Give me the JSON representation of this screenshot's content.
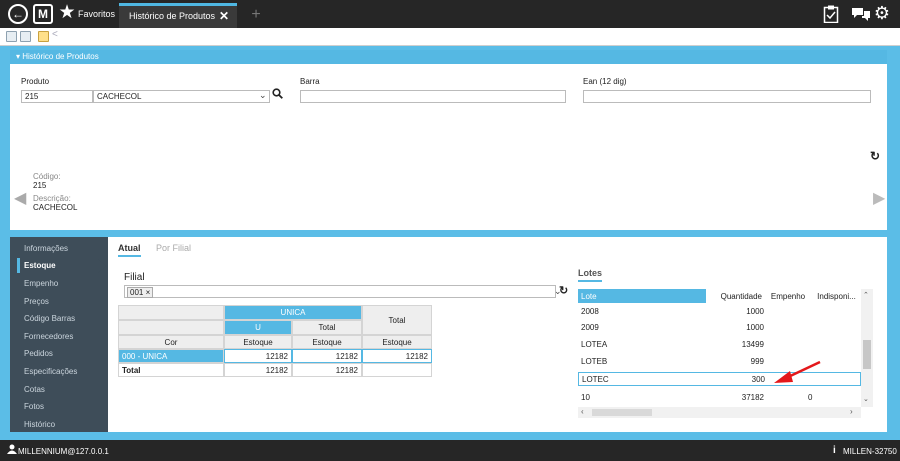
{
  "titlebar": {
    "favorites_label": "Favoritos",
    "active_tab": "Histórico de Produtos",
    "close_glyph": "✕",
    "add_glyph": "+",
    "logo_letter": "M"
  },
  "panel": {
    "title": "Histórico de Produtos"
  },
  "product": {
    "produto_label": "Produto",
    "produto_code": "215",
    "produto_name": "CACHECOL",
    "barra_label": "Barra",
    "barra_value": "",
    "ean_label": "Ean (12 dig)",
    "ean_value": "",
    "codigo_label": "Código:",
    "codigo_value": "215",
    "descricao_label": "Descrição:",
    "descricao_value": "CACHECOL"
  },
  "sidebar": {
    "items": [
      "Informações",
      "Estoque",
      "Empenho",
      "Preços",
      "Código Barras",
      "Fornecedores",
      "Pedidos",
      "Especificações",
      "Cotas",
      "Fotos",
      "Histórico"
    ],
    "active_index": 1
  },
  "content": {
    "tabs": [
      "Atual",
      "Por Filial"
    ],
    "filial_label": "Filial",
    "filial_tag": "001 ×"
  },
  "stock_grid": {
    "group_unica": "UNICA",
    "group_total": "Total",
    "sub_u": "U",
    "sub_total": "Total",
    "col_cor": "Cor",
    "col_estoque": "Estoque",
    "rows": [
      {
        "label": "000 - UNICA",
        "values": [
          "12182",
          "12182",
          "12182"
        ]
      },
      {
        "label": "Total",
        "values": [
          "12182",
          "12182",
          ""
        ]
      }
    ]
  },
  "lotes": {
    "tab": "Lotes",
    "headers": [
      "Lote",
      "Quantidade",
      "Empenho",
      "Indisponi..."
    ],
    "rows": [
      {
        "lote": "2008",
        "qtd": "1000"
      },
      {
        "lote": "2009",
        "qtd": "1000"
      },
      {
        "lote": "LOTEA",
        "qtd": "13499"
      },
      {
        "lote": "LOTEB",
        "qtd": "999"
      },
      {
        "lote": "LOTEC",
        "qtd": "300"
      }
    ],
    "footer": {
      "count": "10",
      "qtd": "37182",
      "empenho": "0"
    }
  },
  "status": {
    "user": "MILLENNIUM@127.0.0.1",
    "server": "MILLEN-32750"
  },
  "colors": {
    "accent": "#55b8e3",
    "sidebar": "#3e4d59",
    "titlebar": "#262626",
    "arrow": "#e4181b"
  }
}
